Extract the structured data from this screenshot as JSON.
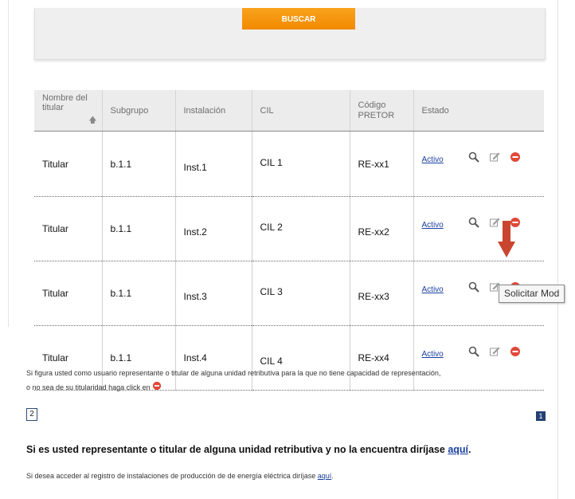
{
  "search": {
    "button_label": "BUSCAR"
  },
  "table": {
    "headers": {
      "titular_line1": "Nombre del",
      "titular_line2": "titular",
      "subgrupo": "Subgrupo",
      "instalacion": "Instalación",
      "cil": "CIL",
      "pretor_line1": "Código",
      "pretor_line2": "PRETOR",
      "estado": "Estado"
    },
    "sort_icon": "up-arrow-icon",
    "rows": [
      {
        "titular": "Titular",
        "subgrupo": "b.1.1",
        "instalacion": "Inst.1",
        "cil": "CIL 1",
        "pretor": "RE-xx1",
        "estado": "Activo"
      },
      {
        "titular": "Titular",
        "subgrupo": "b.1.1",
        "instalacion": "Inst.2",
        "cil": "CIL 2",
        "pretor": "RE-xx2",
        "estado": "Activo"
      },
      {
        "titular": "Titular",
        "subgrupo": "b.1.1",
        "instalacion": "Inst.3",
        "cil": "CIL 3",
        "pretor": "RE-xx3",
        "estado": "Activo"
      },
      {
        "titular": "Titular",
        "subgrupo": "b.1.1",
        "instalacion": "Inst.4",
        "cil": "CIL 4",
        "pretor": "RE-xx4",
        "estado": "Activo"
      }
    ],
    "row_icons": [
      "search-icon",
      "edit-icon",
      "remove-icon"
    ]
  },
  "tooltip": {
    "text": "Solicitar Mod"
  },
  "notice": {
    "line1": "Si figura usted como usuario representante o titular de alguna unidad retributiva para la que no tiene capacidad de representación,",
    "line2": "o no sea de su titularidad haga click en"
  },
  "pagination": {
    "left_page": "2",
    "current_page": "1"
  },
  "bold_notice": {
    "text": "Si es usted representante o titular de alguna unidad retributiva y no la encuentra diríjase",
    "link": "aquí",
    "suffix": "."
  },
  "small_notice": {
    "text": "Si desea acceder al registro de instalaciones de producción de de energía eléctrica diríjase",
    "link": "aquí",
    "suffix": "."
  },
  "colors": {
    "accent_orange": "#f28a00",
    "link_blue": "#1a3fa0",
    "arrow_red": "#c9452f",
    "remove_red": "#e0483a",
    "page_current": "#243f73"
  }
}
